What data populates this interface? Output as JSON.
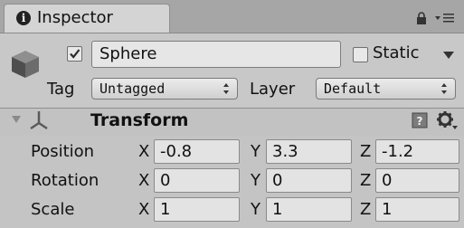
{
  "inspector": {
    "tab_label": "Inspector",
    "icons": {
      "tab": "info-icon",
      "lock": "lock-icon",
      "menu": "panel-menu-icon"
    }
  },
  "gameobject": {
    "active": true,
    "name": "Sphere",
    "static_label": "Static",
    "static": false,
    "tag_label": "Tag",
    "tag_value": "Untagged",
    "layer_label": "Layer",
    "layer_value": "Default"
  },
  "transform": {
    "title": "Transform",
    "rows": [
      {
        "label": "Position",
        "x": "-0.8",
        "y": "3.3",
        "z": "-1.2"
      },
      {
        "label": "Rotation",
        "x": "0",
        "y": "0",
        "z": "0"
      },
      {
        "label": "Scale",
        "x": "1",
        "y": "1",
        "z": "1"
      }
    ],
    "axes": {
      "x": "X",
      "y": "Y",
      "z": "Z"
    }
  },
  "colors": {
    "panel_bg": "#c4c4c4",
    "tab_bar_bg": "#a6a6a6",
    "field_bg": "#e3e3e3"
  }
}
